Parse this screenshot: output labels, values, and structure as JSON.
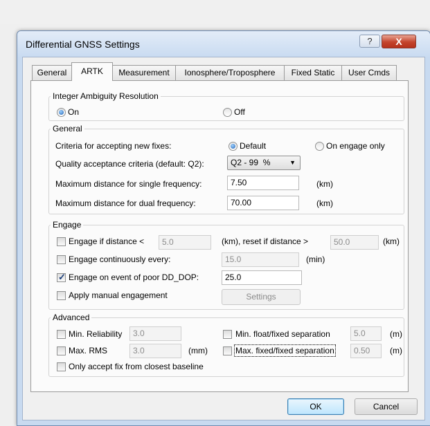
{
  "window": {
    "title": "Differential GNSS Settings",
    "help_label": "?",
    "close_label": "X"
  },
  "tabs": [
    {
      "label": "General"
    },
    {
      "label": "ARTK"
    },
    {
      "label": "Measurement"
    },
    {
      "label": "Ionosphere/Troposphere"
    },
    {
      "label": "Fixed Static"
    },
    {
      "label": "User Cmds"
    }
  ],
  "integer_ambiguity": {
    "legend": "Integer Ambiguity Resolution",
    "on_label": "On",
    "off_label": "Off",
    "selected": "On"
  },
  "general": {
    "legend": "General",
    "criteria_label": "Criteria for accepting new fixes:",
    "default_label": "Default",
    "engage_only_label": "On engage only",
    "quality_label": "Quality acceptance criteria (default: Q2):",
    "quality_value": "Q2 - 99  %",
    "max_single_label": "Maximum distance for single frequency:",
    "max_single_value": "7.50",
    "max_single_unit": "(km)",
    "max_dual_label": "Maximum distance for dual frequency:",
    "max_dual_value": "70.00",
    "max_dual_unit": "(km)"
  },
  "engage": {
    "legend": "Engage",
    "engage_distance_label": "Engage if distance <",
    "engage_distance_value": "5.0",
    "reset_label": "(km), reset if distance >",
    "reset_value": "50.0",
    "reset_unit": "(km)",
    "continuous_label": "Engage continuously every:",
    "continuous_value": "15.0",
    "continuous_unit": "(min)",
    "poor_dop_label": "Engage on event of poor DD_DOP:",
    "poor_dop_value": "25.0",
    "manual_label": "Apply manual engagement",
    "settings_label": "Settings"
  },
  "advanced": {
    "legend": "Advanced",
    "min_reliability_label": "Min. Reliability",
    "min_reliability_value": "3.0",
    "max_rms_label": "Max. RMS",
    "max_rms_value": "3.0",
    "max_rms_unit": "(mm)",
    "min_float_label": "Min. float/fixed separation",
    "min_float_value": "5.0",
    "min_float_unit": "(m)",
    "max_fixed_label": "Max. fixed/fixed separation",
    "max_fixed_value": "0.50",
    "max_fixed_unit": "(m)",
    "closest_baseline_label": "Only accept fix from closest baseline"
  },
  "footer": {
    "ok_label": "OK",
    "cancel_label": "Cancel"
  }
}
